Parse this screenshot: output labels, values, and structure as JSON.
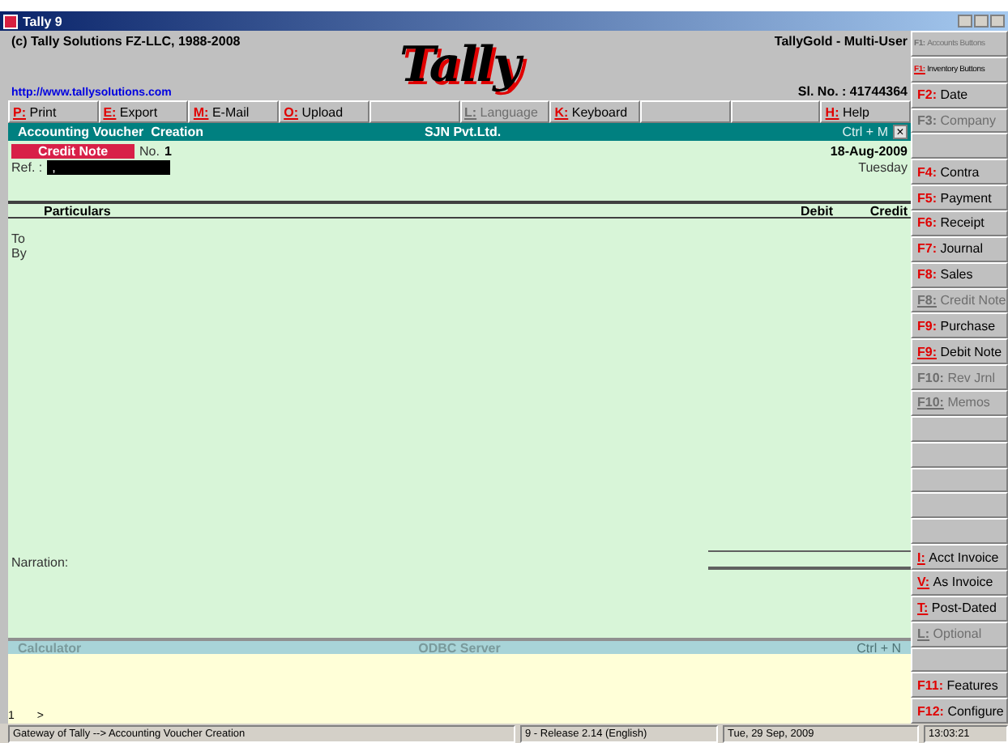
{
  "window": {
    "title": "Tally 9"
  },
  "header": {
    "copyright": "(c) Tally Solutions FZ-LLC, 1988-2008",
    "url": "http://www.tallysolutions.com",
    "logo": "Tally",
    "edition": "TallyGold - Multi-User",
    "serial": "Sl. No. : 41744364"
  },
  "menu": [
    {
      "kind": "button",
      "key": "P:",
      "label": "Print",
      "disabled": false
    },
    {
      "kind": "button",
      "key": "E:",
      "label": "Export",
      "disabled": false
    },
    {
      "kind": "button",
      "key": "M:",
      "label": "E-Mail",
      "disabled": false
    },
    {
      "kind": "button",
      "key": "O:",
      "label": "Upload",
      "disabled": false
    },
    {
      "kind": "blank"
    },
    {
      "kind": "button",
      "key": "L:",
      "label": "Language",
      "disabled": true
    },
    {
      "kind": "button",
      "key": "K:",
      "label": "Keyboard",
      "disabled": false
    },
    {
      "kind": "blank"
    },
    {
      "kind": "blank"
    },
    {
      "kind": "button",
      "key": "H:",
      "label": "Help",
      "disabled": false
    }
  ],
  "voucher_bar": {
    "title": "Accounting Voucher  Creation",
    "company": "SJN Pvt.Ltd.",
    "shortcut": "Ctrl + M",
    "close": "×"
  },
  "voucher": {
    "type": "Credit Note",
    "number_label": "No.",
    "number": "1",
    "ref_label": "Ref. :",
    "ref_value": ",",
    "date": "18-Aug-2009",
    "day": "Tuesday",
    "columns": [
      "Particulars",
      "Debit",
      "Credit"
    ],
    "entries": [
      "To",
      "By"
    ],
    "narration_label": "Narration:"
  },
  "calculator_bar": {
    "title": "Calculator",
    "server": "ODBC Server",
    "shortcut": "Ctrl + N"
  },
  "calculator": {
    "line": "1",
    "prompt": ">"
  },
  "buttons": [
    {
      "kind": "button",
      "key": "F1:",
      "label": "Accounts Buttons",
      "disabled": true,
      "underlined": false,
      "small": true
    },
    {
      "kind": "button",
      "key": "F1:",
      "label": "Inventory Buttons",
      "disabled": false,
      "underlined": true,
      "small": true
    },
    {
      "kind": "button",
      "key": "F2:",
      "label": "Date",
      "disabled": false,
      "underlined": false,
      "small": false
    },
    {
      "kind": "button",
      "key": "F3:",
      "label": "Company",
      "disabled": true,
      "underlined": false,
      "small": false
    },
    {
      "kind": "blank"
    },
    {
      "kind": "button",
      "key": "F4:",
      "label": "Contra",
      "disabled": false,
      "underlined": false,
      "small": false
    },
    {
      "kind": "button",
      "key": "F5:",
      "label": "Payment",
      "disabled": false,
      "underlined": false,
      "small": false
    },
    {
      "kind": "button",
      "key": "F6:",
      "label": "Receipt",
      "disabled": false,
      "underlined": false,
      "small": false
    },
    {
      "kind": "button",
      "key": "F7:",
      "label": "Journal",
      "disabled": false,
      "underlined": false,
      "small": false
    },
    {
      "kind": "button",
      "key": "F8:",
      "label": "Sales",
      "disabled": false,
      "underlined": false,
      "small": false
    },
    {
      "kind": "button",
      "key": "F8:",
      "label": "Credit Note",
      "disabled": true,
      "underlined": true,
      "small": false
    },
    {
      "kind": "button",
      "key": "F9:",
      "label": "Purchase",
      "disabled": false,
      "underlined": false,
      "small": false
    },
    {
      "kind": "button",
      "key": "F9:",
      "label": "Debit Note",
      "disabled": false,
      "underlined": true,
      "small": false
    },
    {
      "kind": "button",
      "key": "F10:",
      "label": "Rev Jrnl",
      "disabled": true,
      "underlined": false,
      "small": false
    },
    {
      "kind": "button",
      "key": "F10:",
      "label": "Memos",
      "disabled": true,
      "underlined": true,
      "small": false
    },
    {
      "kind": "blank"
    },
    {
      "kind": "blank"
    },
    {
      "kind": "blank"
    },
    {
      "kind": "blank"
    },
    {
      "kind": "blank"
    },
    {
      "kind": "button",
      "key": "I:",
      "label": "Acct Invoice",
      "disabled": false,
      "underlined": true,
      "small": false
    },
    {
      "kind": "button",
      "key": "V:",
      "label": "As Invoice",
      "disabled": false,
      "underlined": true,
      "small": false
    },
    {
      "kind": "button",
      "key": "T:",
      "label": "Post-Dated",
      "disabled": false,
      "underlined": true,
      "small": false
    },
    {
      "kind": "button",
      "key": "L:",
      "label": "Optional",
      "disabled": true,
      "underlined": true,
      "small": false
    },
    {
      "kind": "blank"
    },
    {
      "kind": "button",
      "key": "F11:",
      "label": "Features",
      "disabled": false,
      "underlined": false,
      "small": false
    },
    {
      "kind": "button",
      "key": "F12:",
      "label": "Configure",
      "disabled": false,
      "underlined": false,
      "small": false
    }
  ],
  "status_bar": {
    "path": "Gateway of Tally --> Accounting Voucher  Creation",
    "release": "9 - Release 2.14 (English)",
    "date": "Tue, 29 Sep, 2009",
    "time": "13:03:21"
  }
}
